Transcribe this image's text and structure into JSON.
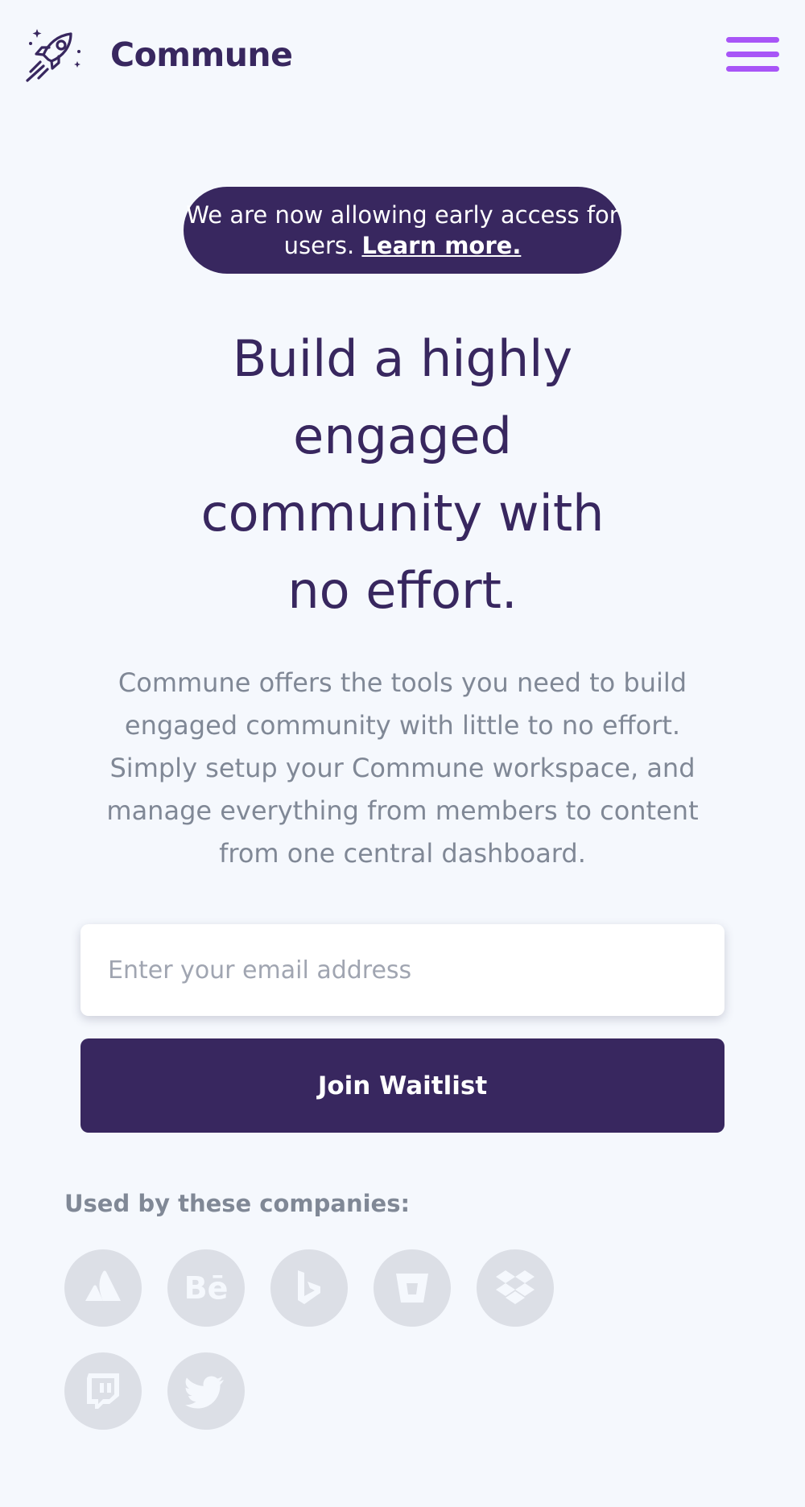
{
  "header": {
    "brand": "Commune",
    "logo_icon": "rocket-icon",
    "menu_icon": "hamburger-menu-icon"
  },
  "notice": {
    "text": "We are now allowing early access for users.",
    "link": "Learn more."
  },
  "hero": {
    "headline": "Build a highly engaged community with no effort.",
    "description": "Commune offers the tools you need to build engaged community with little to no effort. Simply setup your Commune workspace, and manage everything from members to content from one central dashboard."
  },
  "form": {
    "email_placeholder": "Enter your email address",
    "email_value": "",
    "submit_label": "Join Waitlist"
  },
  "companies": {
    "label": "Used by these companies:",
    "logos": [
      {
        "name": "atlassian",
        "icon": "atlassian-icon"
      },
      {
        "name": "behance",
        "icon": "behance-icon",
        "text": "Bē"
      },
      {
        "name": "bing",
        "icon": "bing-icon"
      },
      {
        "name": "bitbucket",
        "icon": "bitbucket-icon"
      },
      {
        "name": "dropbox",
        "icon": "dropbox-icon"
      },
      {
        "name": "twitch",
        "icon": "twitch-icon"
      },
      {
        "name": "twitter",
        "icon": "twitter-icon"
      }
    ]
  },
  "colors": {
    "background": "#f5f8fd",
    "primary": "#38275f",
    "accent": "#a855f7",
    "muted_text": "#808896",
    "logo_circle": "#dcdfe6"
  }
}
